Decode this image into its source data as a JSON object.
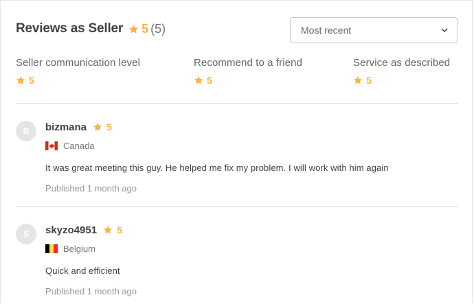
{
  "header": {
    "title": "Reviews as Seller",
    "rating": "5",
    "count": "(5)"
  },
  "sort": {
    "selected": "Most recent"
  },
  "breakdown": [
    {
      "label": "Seller communication level",
      "score": "5"
    },
    {
      "label": "Recommend to a friend",
      "score": "5"
    },
    {
      "label": "Service as described",
      "score": "5"
    }
  ],
  "reviews": [
    {
      "initial": "B",
      "username": "bizmana",
      "rating": "5",
      "country": "Canada",
      "flag": "canada-flag",
      "comment": "It was great meeting this guy. He helped me fix my problem. I will work with him again",
      "published": "Published 1 month ago"
    },
    {
      "initial": "S",
      "username": "skyzo4951",
      "rating": "5",
      "country": "Belgium",
      "flag": "belgium-flag",
      "comment": "Quick and efficient",
      "published": "Published 1 month ago"
    }
  ],
  "colors": {
    "star": "#ffb33e",
    "text": "#404145",
    "muted": "#74767e",
    "divider": "#dadbdd"
  }
}
